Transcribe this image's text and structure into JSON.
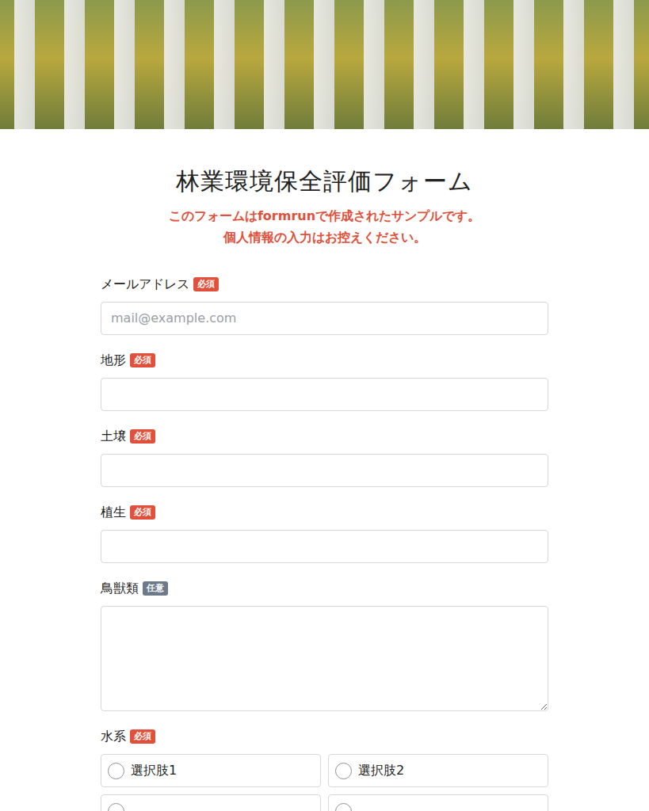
{
  "form": {
    "title": "林業環境保全評価フォーム",
    "notice": [
      "このフォームはformrunで作成されたサンプルです。",
      "個人情報の入力はお控えください。"
    ],
    "fields": [
      {
        "kind": "text",
        "label": "メールアドレス",
        "badge": "必須",
        "required": true,
        "placeholder": "mail@example.com"
      },
      {
        "kind": "text",
        "label": "地形",
        "badge": "必須",
        "required": true,
        "placeholder": ""
      },
      {
        "kind": "text",
        "label": "土壌",
        "badge": "必須",
        "required": true,
        "placeholder": ""
      },
      {
        "kind": "text",
        "label": "植生",
        "badge": "必須",
        "required": true,
        "placeholder": ""
      },
      {
        "kind": "textarea",
        "label": "鳥獣類",
        "badge": "任意",
        "required": false,
        "placeholder": ""
      },
      {
        "kind": "radio",
        "label": "水系",
        "badge": "必須",
        "required": true,
        "options": [
          {
            "label": "選択肢1",
            "selected": false
          },
          {
            "label": "選択肢2",
            "selected": false
          },
          {
            "label": "",
            "selected": false
          },
          {
            "label": "",
            "selected": false
          }
        ]
      }
    ]
  }
}
